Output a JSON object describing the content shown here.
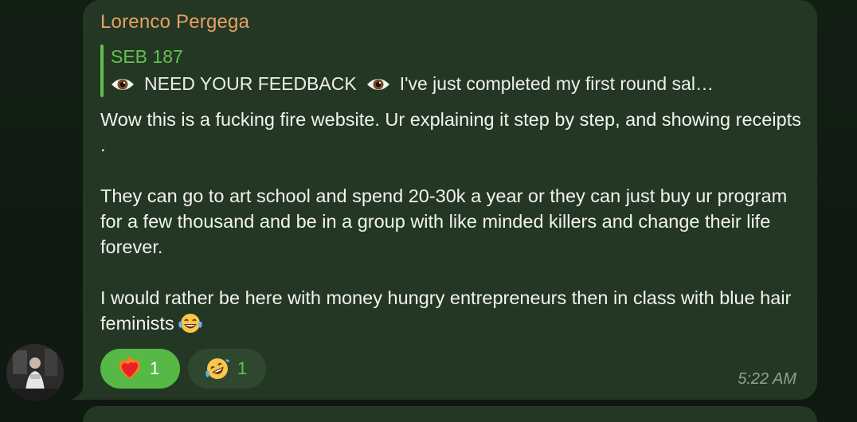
{
  "message": {
    "sender": "Lorenco Pergega",
    "reply": {
      "author": "SEB 187",
      "preview_title": "NEED YOUR FEEDBACK",
      "preview_text": "I've just completed my first round sal…"
    },
    "paragraphs": [
      "Wow this is a fucking fire website. Ur explaining it step by step, and showing receipts .",
      "They can go to art school and spend 20-30k a year or they can just buy ur program for a few thousand and be in a group with like minded killers and change their life forever.",
      "I would rather be here with money hungry entrepreneurs then in class with blue hair feminists"
    ],
    "timestamp": "5:22 AM",
    "reactions": [
      {
        "emoji": "heart-on-fire-icon",
        "count": "1",
        "active": true
      },
      {
        "emoji": "rofl-icon",
        "count": "1",
        "active": false
      }
    ]
  },
  "colors": {
    "bubble": "#243724",
    "sender": "#e8a062",
    "accent_green": "#5fc14b",
    "text": "#f1f3f1",
    "timestamp": "#8aa58a"
  }
}
